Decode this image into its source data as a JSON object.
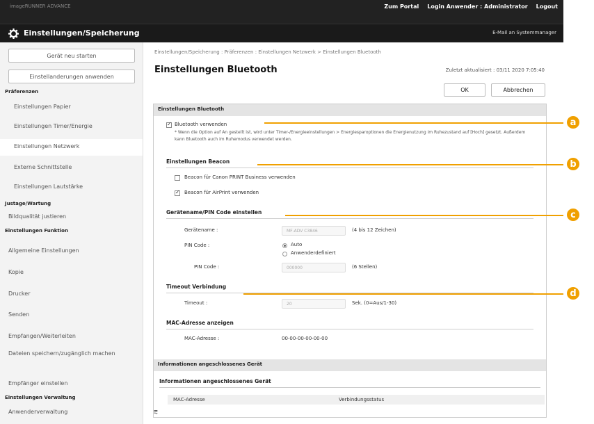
{
  "topbar": {
    "left_info": "imageRUNNER ADVANCE",
    "portal": "Zum Portal",
    "login": "Login Anwender : Administrator",
    "logout": "Logout"
  },
  "title_bar": {
    "title": "Einstellungen/Speicherung",
    "mail": "E-Mail an Systemmanager"
  },
  "sidebar": {
    "restart_button": "Gerät neu starten",
    "apply_button": "Einstellanderungen anwenden",
    "sections": [
      {
        "head": "Präferenzen",
        "items": [
          "Einstellungen Papier",
          "Einstellungen Timer/Energie",
          "Einstellungen Netzwerk",
          "Externe Schnittstelle",
          "Einstellungen Lautstärke"
        ]
      },
      {
        "head": "Justage/Wartung",
        "items": [
          "Bildqualität justieren"
        ]
      },
      {
        "head": "Einstellungen Funktion",
        "items": [
          "Allgemeine Einstellungen",
          "Kopie",
          "Drucker",
          "Senden",
          "Empfangen/Weiterleiten",
          "Dateien speichern/zugänglich machen",
          "Empfänger einstellen"
        ]
      },
      {
        "head": "Einstellungen Verwaltung",
        "items": [
          "Anwenderverwaltung"
        ]
      }
    ]
  },
  "main": {
    "breadcrumb": "Einstellungen/Speicherung : Präferenzen : Einstellungen Netzwerk > Einstellungen Bluetooth",
    "title": "Einstellungen Bluetooth",
    "updated": "Zuletzt aktualisiert : 03/11 2020 7:05:40",
    "ok": "OK",
    "cancel": "Abbrechen",
    "section1": "Einstellungen Bluetooth",
    "bt_use_label": "Bluetooth verwenden",
    "bt_note": "* Wenn die Option auf An gestellt ist, wird unter Timer-/Energieeinstellungen > Energiesparoptionen die Energienutzung im Ruhezustand auf [Hoch] gesetzt. Außerdem kann Bluetooth auch im Ruhemodus verwendet werden.",
    "beacon_head": "Einstellungen Beacon",
    "beacon_canon": "Beacon für Canon PRINT Business verwenden",
    "beacon_airprint": "Beacon für AirPrint verwenden",
    "device_head": "Gerätename/PIN Code einstellen",
    "device_name_label": "Gerätename :",
    "device_name_value": "MF-ADV C3846",
    "device_name_hint": "(4 bis 12 Zeichen)",
    "pin_label": "PIN Code :",
    "pin_auto": "Auto",
    "pin_custom": "Anwenderdefiniert",
    "pin_code_label": "PIN Code :",
    "pin_code_value": "000000",
    "pin_code_hint": "(6 Stellen)",
    "timeout_head": "Timeout Verbindung",
    "timeout_label": "Timeout :",
    "timeout_value": "20",
    "timeout_hint": "Sek. (0=Aus/1-30)",
    "mac_head": "MAC-Adresse anzeigen",
    "mac_label": "MAC-Adresse :",
    "mac_value": "00-00-00-00-00-00",
    "section2": "Informationen angeschlossenes Gerät",
    "section2_sub": "Informationen angeschlossenes Gerät",
    "col_mac": "MAC-Adresse",
    "col_status": "Verbindungsstatus"
  },
  "callouts": [
    "a",
    "b",
    "c",
    "d"
  ],
  "colors": {
    "accent": "#f0a000",
    "topbar": "#222222"
  }
}
